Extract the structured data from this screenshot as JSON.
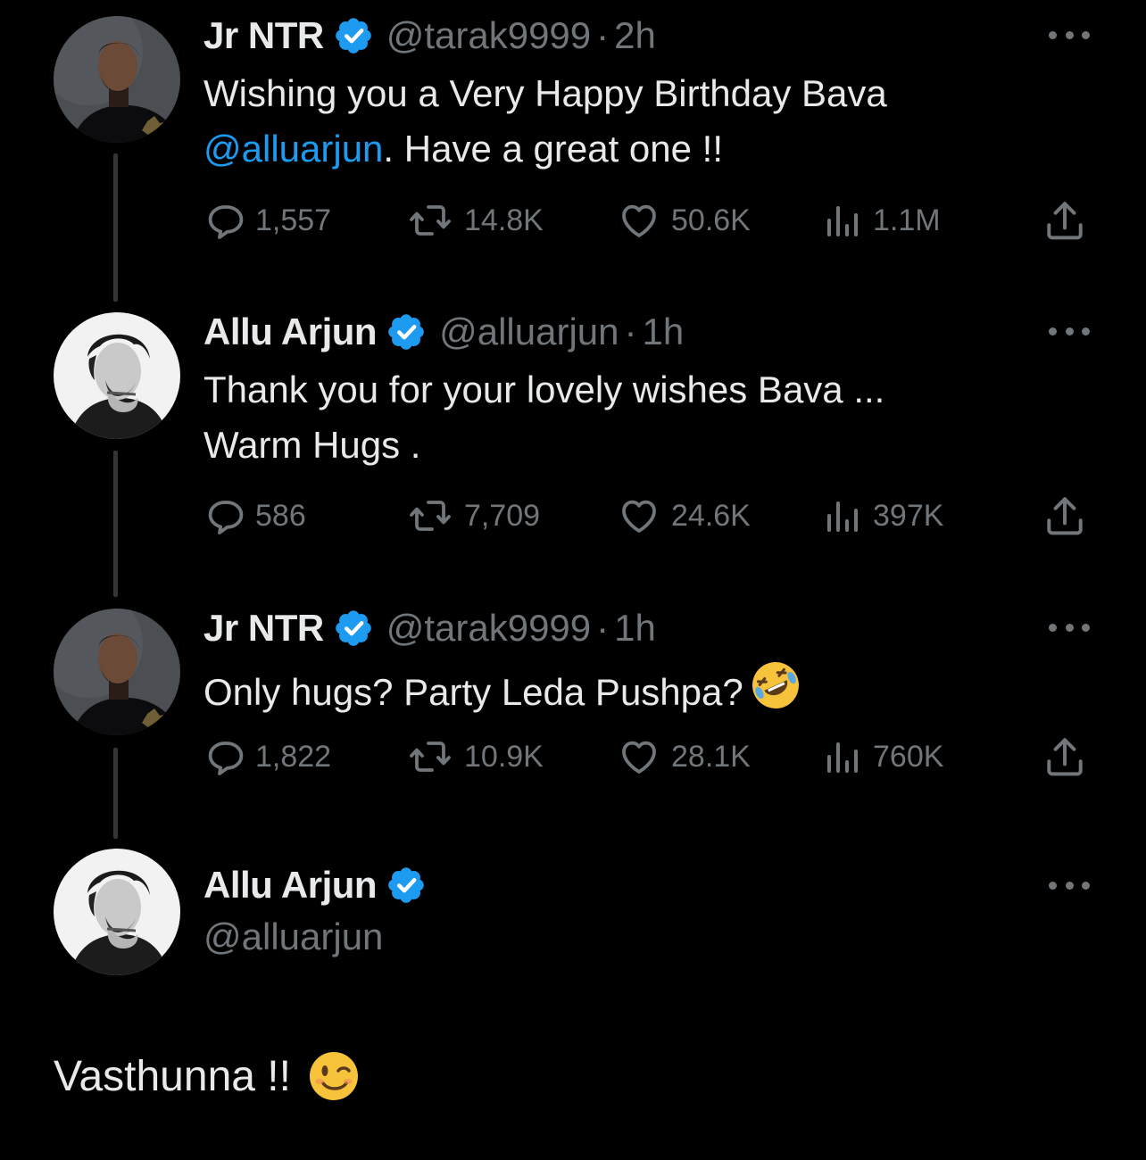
{
  "tweets": [
    {
      "name": "Jr NTR",
      "handle": "@tarak9999",
      "separator": "·",
      "time": "2h",
      "text_line1": "Wishing you a Very Happy Birthday Bava",
      "mention": "@alluarjun",
      "text_line2_rest": ". Have a great one !!",
      "replies": "1,557",
      "retweets": "14.8K",
      "likes": "50.6K",
      "views": "1.1M"
    },
    {
      "name": "Allu Arjun",
      "handle": "@alluarjun",
      "separator": "·",
      "time": "1h",
      "text_line1": "Thank you for your lovely wishes Bava ...",
      "text_line2": "Warm Hugs .",
      "replies": "586",
      "retweets": "7,709",
      "likes": "24.6K",
      "views": "397K"
    },
    {
      "name": "Jr NTR",
      "handle": "@tarak9999",
      "separator": "·",
      "time": "1h",
      "text_line1": "Only hugs?  Party Leda Pushpa?",
      "emoji": "rolling-on-floor-laughing",
      "replies": "1,822",
      "retweets": "10.9K",
      "likes": "28.1K",
      "views": "760K"
    },
    {
      "name": "Allu Arjun",
      "handle": "@alluarjun",
      "text": "Vasthunna !!",
      "emoji": "winking-face"
    }
  ],
  "icons": {
    "verified": "verified-badge-icon",
    "more": "more-options-icon",
    "reply": "reply-icon",
    "retweet": "retweet-icon",
    "like": "heart-icon",
    "views": "views-icon",
    "share": "share-icon"
  },
  "colors": {
    "background": "#000000",
    "text": "#e7e9ea",
    "muted": "#71767b",
    "accent": "#1d9bf0",
    "thread_line": "#333639"
  }
}
